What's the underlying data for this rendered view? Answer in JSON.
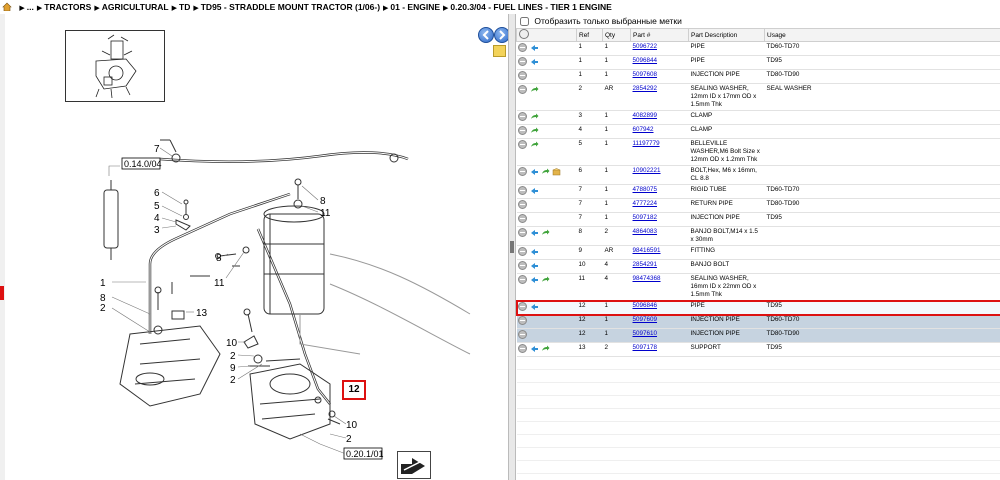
{
  "breadcrumb": [
    "...",
    "TRACTORS",
    "AGRICULTURAL",
    "TD",
    "TD95 - STRADDLE MOUNT TRACTOR (1/06-)",
    "01 - ENGINE",
    "0.20.3/04 - FUEL LINES - TIER 1 ENGINE"
  ],
  "diagram": {
    "callouts": [
      "7",
      "0.14.0/04",
      "6",
      "5",
      "4",
      "3",
      "8",
      "11",
      "8",
      "11",
      "1",
      "8",
      "2",
      "13",
      "10",
      "2",
      "9",
      "2",
      "12",
      "10",
      "2",
      "0.20.1/01"
    ],
    "highlight": "12"
  },
  "filter": {
    "label": "Отобразить только выбранные метки"
  },
  "table": {
    "headers": [
      "",
      "Ref",
      "Qty",
      "Part #",
      "Part Description",
      "Usage"
    ],
    "rows": [
      {
        "ref": "1",
        "qty": "1",
        "part": "5096722",
        "desc": "PIPE",
        "usage": "TD60-TD70",
        "icons": [
          "cart"
        ],
        "state": ""
      },
      {
        "ref": "1",
        "qty": "1",
        "part": "5096844",
        "desc": "PIPE",
        "usage": "TD95",
        "icons": [
          "cart"
        ],
        "state": ""
      },
      {
        "ref": "1",
        "qty": "1",
        "part": "5097608",
        "desc": "INJECTION PIPE",
        "usage": "TD80-TD90",
        "icons": [],
        "state": ""
      },
      {
        "ref": "2",
        "qty": "AR",
        "part": "2854292",
        "desc": "SEALING WASHER, 12mm ID x 17mm OD x 1.5mm Thk",
        "usage": "SEAL WASHER",
        "icons": [
          "arrow"
        ],
        "state": ""
      },
      {
        "ref": "3",
        "qty": "1",
        "part": "4082899",
        "desc": "CLAMP",
        "usage": "",
        "icons": [
          "arrow"
        ],
        "state": ""
      },
      {
        "ref": "4",
        "qty": "1",
        "part": "607942",
        "desc": "CLAMP",
        "usage": "",
        "icons": [
          "arrow"
        ],
        "state": ""
      },
      {
        "ref": "5",
        "qty": "1",
        "part": "11197779",
        "desc": "BELLEVILLE WASHER,M6 Bolt Size x 12mm OD x 1.2mm Thk",
        "usage": "",
        "icons": [
          "arrow"
        ],
        "state": ""
      },
      {
        "ref": "6",
        "qty": "1",
        "part": "10902221",
        "desc": "BOLT,Hex, M6 x 16mm, CL 8.8",
        "usage": "",
        "icons": [
          "cart",
          "arrow",
          "box"
        ],
        "state": ""
      },
      {
        "ref": "7",
        "qty": "1",
        "part": "4788075",
        "desc": "RIGID TUBE",
        "usage": "TD60-TD70",
        "icons": [
          "cart"
        ],
        "state": ""
      },
      {
        "ref": "7",
        "qty": "1",
        "part": "4777224",
        "desc": "RETURN PIPE",
        "usage": "TD80-TD90",
        "icons": [],
        "state": ""
      },
      {
        "ref": "7",
        "qty": "1",
        "part": "5097182",
        "desc": "INJECTION PIPE",
        "usage": "TD95",
        "icons": [],
        "state": ""
      },
      {
        "ref": "8",
        "qty": "2",
        "part": "4864083",
        "desc": "BANJO BOLT,M14 x 1.5 x 30mm",
        "usage": "",
        "icons": [
          "cart",
          "arrow"
        ],
        "state": ""
      },
      {
        "ref": "9",
        "qty": "AR",
        "part": "98416591",
        "desc": "FITTING",
        "usage": "",
        "icons": [
          "cart"
        ],
        "state": ""
      },
      {
        "ref": "10",
        "qty": "4",
        "part": "2854291",
        "desc": "BANJO BOLT",
        "usage": "",
        "icons": [
          "cart"
        ],
        "state": ""
      },
      {
        "ref": "11",
        "qty": "4",
        "part": "98474368",
        "desc": "SEALING WASHER, 16mm ID x 22mm OD x 1.5mm Thk",
        "usage": "",
        "icons": [
          "cart",
          "arrow"
        ],
        "state": ""
      },
      {
        "ref": "12",
        "qty": "1",
        "part": "5096846",
        "desc": "PIPE",
        "usage": "TD95",
        "icons": [
          "cart"
        ],
        "state": "cur"
      },
      {
        "ref": "12",
        "qty": "1",
        "part": "5097609",
        "desc": "INJECTION PIPE",
        "usage": "TD60-TD70",
        "icons": [],
        "state": "sel"
      },
      {
        "ref": "12",
        "qty": "1",
        "part": "5097610",
        "desc": "INJECTION PIPE",
        "usage": "TD80-TD90",
        "icons": [],
        "state": "sel"
      },
      {
        "ref": "13",
        "qty": "2",
        "part": "5097178",
        "desc": "SUPPORT",
        "usage": "TD95",
        "icons": [
          "cart",
          "arrow"
        ],
        "state": ""
      }
    ]
  },
  "colors": {
    "link": "#0000cc",
    "highlight": "#dd1111",
    "selected_row": "#c6d3e0"
  }
}
